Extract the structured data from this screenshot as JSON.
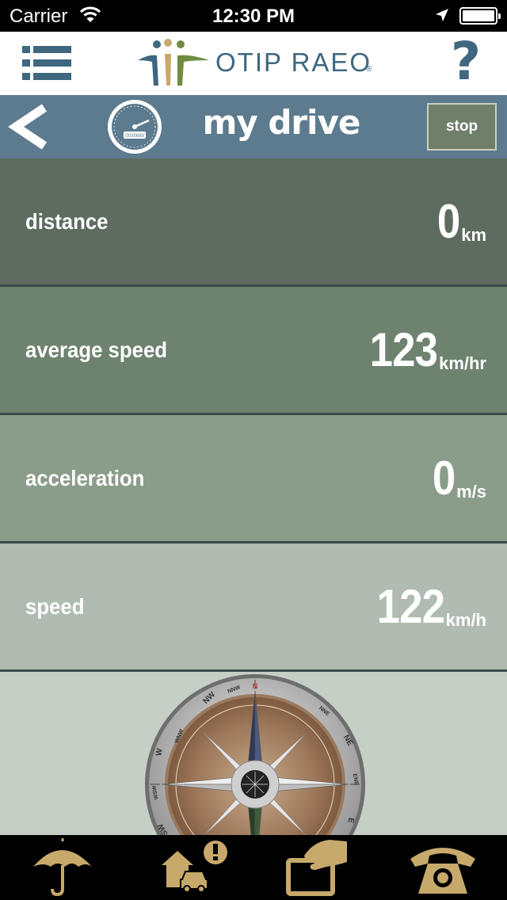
{
  "status_bar": {
    "carrier": "Carrier",
    "time": "12:30 PM"
  },
  "header": {
    "logo_text": "OTIP RAEO",
    "logo_reg": "®",
    "help_label": "?"
  },
  "nav": {
    "title": "my drive",
    "stop_label": "stop",
    "gauge_odometer": "0035689"
  },
  "metrics": [
    {
      "label": "distance",
      "value": "0",
      "unit": "km",
      "background": "#5d6c5f"
    },
    {
      "label": "average speed",
      "value": "123",
      "unit": "km/hr",
      "background": "#6e8270"
    },
    {
      "label": "acceleration",
      "value": "0",
      "unit": "m/s",
      "background": "#8a9c8a"
    },
    {
      "label": "speed",
      "value": "122",
      "unit": "km/h",
      "background": "#b0bcb1"
    }
  ],
  "compass": {
    "labels": [
      "N",
      "NNW",
      "NW",
      "WNW",
      "W",
      "WSW",
      "SW",
      "NNE",
      "NE",
      "ENE",
      "E"
    ]
  },
  "tabs": [
    {
      "icon": "umbrella-icon"
    },
    {
      "icon": "home-car-alert-icon"
    },
    {
      "icon": "card-hand-icon"
    },
    {
      "icon": "phone-icon"
    }
  ],
  "colors": {
    "brand_blue": "#3f6780",
    "nav_bg": "#5d7b8e",
    "gold": "#c6a96b",
    "status_bg": "#000000"
  }
}
